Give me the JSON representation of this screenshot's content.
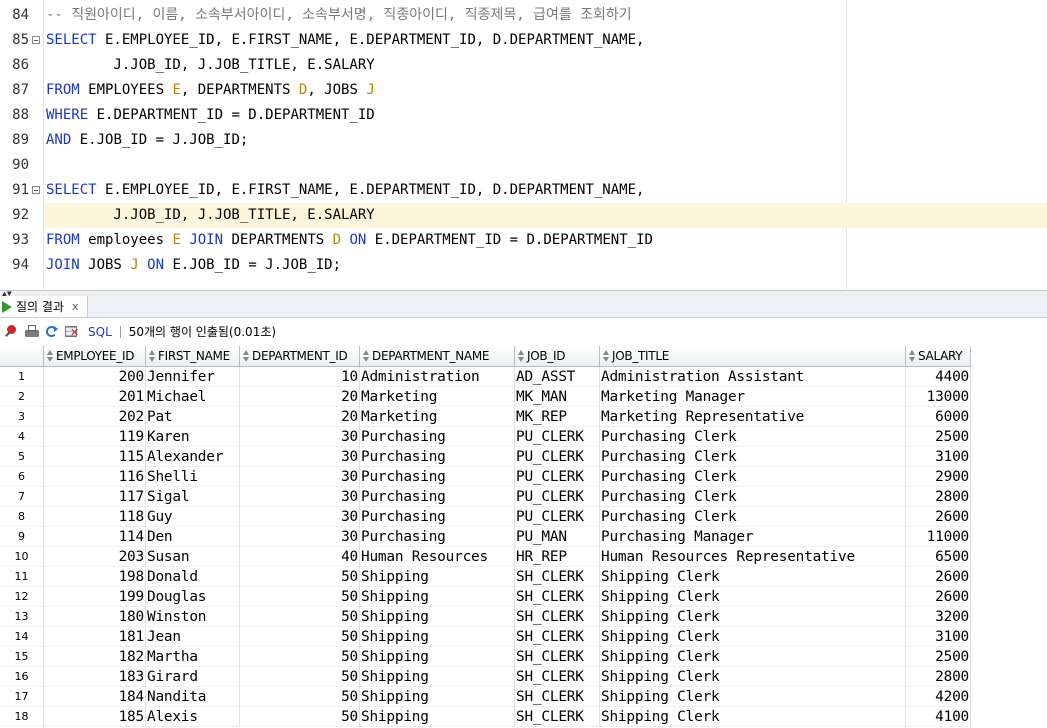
{
  "editor": {
    "lines": [
      {
        "num": "84",
        "fold": false,
        "current": false,
        "tokens": [
          {
            "t": "-- 직원아이디, 이름, 소속부서아이디, 소속부서명, 직종아이디, 직종제목, 급여를 조회하기",
            "c": "cm"
          }
        ]
      },
      {
        "num": "85",
        "fold": true,
        "current": false,
        "tokens": [
          {
            "t": "SELECT",
            "c": "kw"
          },
          {
            "t": " E.EMPLOYEE_ID, E.FIRST_NAME, E.DEPARTMENT_ID, D.DEPARTMENT_NAME,"
          }
        ]
      },
      {
        "num": "86",
        "fold": false,
        "current": false,
        "tokens": [
          {
            "t": "        J.JOB_ID, J.JOB_TITLE, E.SALARY"
          }
        ]
      },
      {
        "num": "87",
        "fold": false,
        "current": false,
        "tokens": [
          {
            "t": "FROM",
            "c": "kw"
          },
          {
            "t": " EMPLOYEES "
          },
          {
            "t": "E",
            "c": "al"
          },
          {
            "t": ", DEPARTMENTS "
          },
          {
            "t": "D",
            "c": "al"
          },
          {
            "t": ", JOBS "
          },
          {
            "t": "J",
            "c": "al"
          }
        ]
      },
      {
        "num": "88",
        "fold": false,
        "current": false,
        "tokens": [
          {
            "t": "WHERE",
            "c": "kw"
          },
          {
            "t": " E.DEPARTMENT_ID = D.DEPARTMENT_ID"
          }
        ]
      },
      {
        "num": "89",
        "fold": false,
        "current": false,
        "tokens": [
          {
            "t": "AND",
            "c": "kw"
          },
          {
            "t": " E.JOB_ID = J.JOB_ID;"
          }
        ]
      },
      {
        "num": "90",
        "fold": false,
        "current": false,
        "tokens": []
      },
      {
        "num": "91",
        "fold": true,
        "current": false,
        "tokens": [
          {
            "t": "SELECT",
            "c": "kw"
          },
          {
            "t": " E.EMPLOYEE_ID, E.FIRST_NAME, E.DEPARTMENT_ID, D.DEPARTMENT_NAME,"
          }
        ]
      },
      {
        "num": "92",
        "fold": false,
        "current": true,
        "tokens": [
          {
            "t": "        J.JOB_ID, J.JOB_TITLE, E.SALARY"
          }
        ]
      },
      {
        "num": "93",
        "fold": false,
        "current": false,
        "tokens": [
          {
            "t": "FROM",
            "c": "kw"
          },
          {
            "t": " employees "
          },
          {
            "t": "E",
            "c": "al"
          },
          {
            "t": " "
          },
          {
            "t": "JOIN",
            "c": "kw"
          },
          {
            "t": " DEPARTMENTS "
          },
          {
            "t": "D",
            "c": "al"
          },
          {
            "t": " "
          },
          {
            "t": "ON",
            "c": "kw"
          },
          {
            "t": " E.DEPARTMENT_ID = D.DEPARTMENT_ID"
          }
        ]
      },
      {
        "num": "94",
        "fold": false,
        "current": false,
        "tokens": [
          {
            "t": "JOIN",
            "c": "kw"
          },
          {
            "t": " JOBS "
          },
          {
            "t": "J",
            "c": "al"
          },
          {
            "t": " "
          },
          {
            "t": "ON",
            "c": "kw"
          },
          {
            "t": " E.JOB_ID = J.JOB_ID;"
          }
        ]
      }
    ]
  },
  "results": {
    "tab_label": "질의 결과",
    "tab_close": "x",
    "toolbar": {
      "sql_label": "SQL",
      "status": "50개의 행이 인출됨(0.01초)"
    },
    "columns": [
      {
        "label": "EMPLOYEE_ID",
        "align": "num"
      },
      {
        "label": "FIRST_NAME",
        "align": "txt"
      },
      {
        "label": "DEPARTMENT_ID",
        "align": "num"
      },
      {
        "label": "DEPARTMENT_NAME",
        "align": "txt"
      },
      {
        "label": "JOB_ID",
        "align": "txt"
      },
      {
        "label": "JOB_TITLE",
        "align": "txt"
      },
      {
        "label": "SALARY",
        "align": "num"
      }
    ],
    "rows": [
      [
        "1",
        "200",
        "Jennifer",
        "10",
        "Administration",
        "AD_ASST",
        "Administration Assistant",
        "4400"
      ],
      [
        "2",
        "201",
        "Michael",
        "20",
        "Marketing",
        "MK_MAN",
        "Marketing Manager",
        "13000"
      ],
      [
        "3",
        "202",
        "Pat",
        "20",
        "Marketing",
        "MK_REP",
        "Marketing Representative",
        "6000"
      ],
      [
        "4",
        "119",
        "Karen",
        "30",
        "Purchasing",
        "PU_CLERK",
        "Purchasing Clerk",
        "2500"
      ],
      [
        "5",
        "115",
        "Alexander",
        "30",
        "Purchasing",
        "PU_CLERK",
        "Purchasing Clerk",
        "3100"
      ],
      [
        "6",
        "116",
        "Shelli",
        "30",
        "Purchasing",
        "PU_CLERK",
        "Purchasing Clerk",
        "2900"
      ],
      [
        "7",
        "117",
        "Sigal",
        "30",
        "Purchasing",
        "PU_CLERK",
        "Purchasing Clerk",
        "2800"
      ],
      [
        "8",
        "118",
        "Guy",
        "30",
        "Purchasing",
        "PU_CLERK",
        "Purchasing Clerk",
        "2600"
      ],
      [
        "9",
        "114",
        "Den",
        "30",
        "Purchasing",
        "PU_MAN",
        "Purchasing Manager",
        "11000"
      ],
      [
        "10",
        "203",
        "Susan",
        "40",
        "Human Resources",
        "HR_REP",
        "Human Resources Representative",
        "6500"
      ],
      [
        "11",
        "198",
        "Donald",
        "50",
        "Shipping",
        "SH_CLERK",
        "Shipping Clerk",
        "2600"
      ],
      [
        "12",
        "199",
        "Douglas",
        "50",
        "Shipping",
        "SH_CLERK",
        "Shipping Clerk",
        "2600"
      ],
      [
        "13",
        "180",
        "Winston",
        "50",
        "Shipping",
        "SH_CLERK",
        "Shipping Clerk",
        "3200"
      ],
      [
        "14",
        "181",
        "Jean",
        "50",
        "Shipping",
        "SH_CLERK",
        "Shipping Clerk",
        "3100"
      ],
      [
        "15",
        "182",
        "Martha",
        "50",
        "Shipping",
        "SH_CLERK",
        "Shipping Clerk",
        "2500"
      ],
      [
        "16",
        "183",
        "Girard",
        "50",
        "Shipping",
        "SH_CLERK",
        "Shipping Clerk",
        "2800"
      ],
      [
        "17",
        "184",
        "Nandita",
        "50",
        "Shipping",
        "SH_CLERK",
        "Shipping Clerk",
        "4200"
      ],
      [
        "18",
        "185",
        "Alexis",
        "50",
        "Shipping",
        "SH_CLERK",
        "Shipping Clerk",
        "4100"
      ]
    ]
  },
  "colors": {
    "keyword": "#1a37c7",
    "alias": "#b8860b",
    "comment": "#7a7a7a",
    "current_line": "#fdf6dc",
    "run_icon": "#2e9a2e"
  }
}
